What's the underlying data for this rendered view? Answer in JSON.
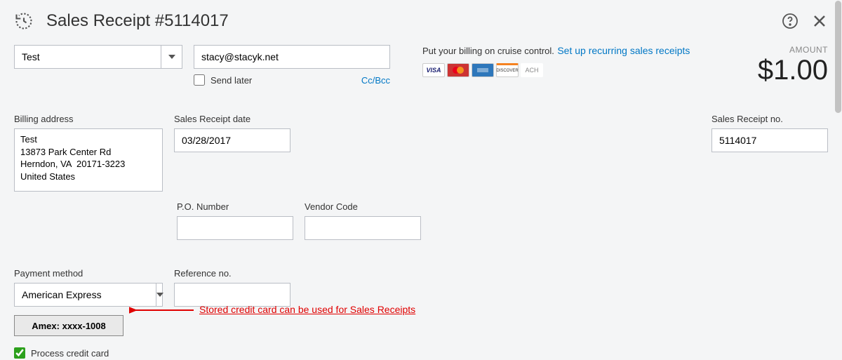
{
  "header": {
    "title": "Sales Receipt #5114017"
  },
  "customer": {
    "value": "Test"
  },
  "email": {
    "value": "stacy@stacyk.net",
    "send_later_label": "Send later",
    "ccbcc": "Cc/Bcc"
  },
  "promo": {
    "text": "Put your billing on cruise control.",
    "link": "Set up recurring sales receipts"
  },
  "cards": {
    "visa": "VISA",
    "mc": "MasterCard",
    "amex": "AMEX",
    "disc": "DISCOVER",
    "ach": "ACH"
  },
  "amount": {
    "label": "AMOUNT",
    "value": "$1.00"
  },
  "labels": {
    "billing": "Billing address",
    "receipt_date": "Sales Receipt date",
    "receipt_no": "Sales Receipt no.",
    "po_number": "P.O. Number",
    "vendor_code": "Vendor Code",
    "payment_method": "Payment method",
    "reference_no": "Reference no.",
    "process_cc": "Process credit card"
  },
  "billing_address": "Test\n13873 Park Center Rd\nHerndon, VA  20171-3223\nUnited States",
  "receipt_date": "03/28/2017",
  "receipt_no": "5114017",
  "po_number": "",
  "vendor_code": "",
  "payment_method": "American Express",
  "reference_no": "",
  "stored_card_label": "Amex: xxxx-1008",
  "annotation": "Stored credit card can be used for Sales Receipts"
}
